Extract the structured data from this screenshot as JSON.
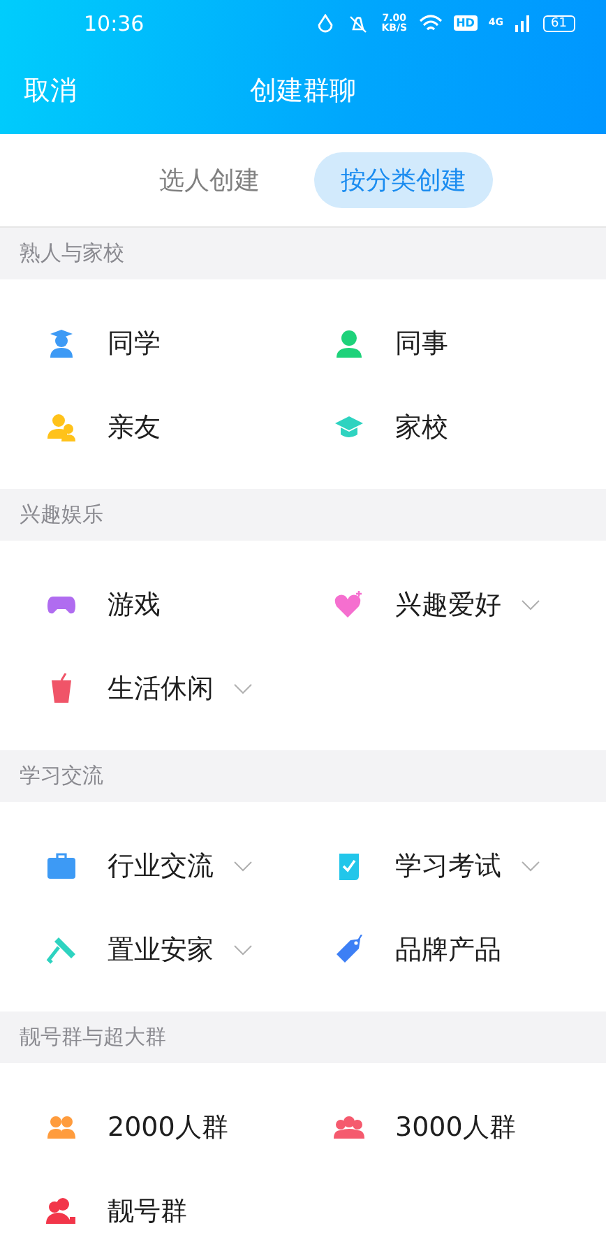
{
  "status_bar": {
    "time": "10:36",
    "speed": "7.00",
    "speed_unit": "KB/S",
    "hd": "HD",
    "network": "4G",
    "battery": "61"
  },
  "header": {
    "cancel": "取消",
    "title": "创建群聊"
  },
  "tabs": [
    {
      "label": "选人创建",
      "selected": false
    },
    {
      "label": "按分类创建",
      "selected": true
    }
  ],
  "sections": [
    {
      "title": "熟人与家校",
      "items": [
        {
          "label": "同学",
          "dropdown": false
        },
        {
          "label": "同事",
          "dropdown": false
        },
        {
          "label": "亲友",
          "dropdown": false
        },
        {
          "label": "家校",
          "dropdown": false
        }
      ]
    },
    {
      "title": "兴趣娱乐",
      "items": [
        {
          "label": "游戏",
          "dropdown": false
        },
        {
          "label": "兴趣爱好",
          "dropdown": true
        },
        {
          "label": "生活休闲",
          "dropdown": true
        }
      ]
    },
    {
      "title": "学习交流",
      "items": [
        {
          "label": "行业交流",
          "dropdown": true
        },
        {
          "label": "学习考试",
          "dropdown": true
        },
        {
          "label": "置业安家",
          "dropdown": true
        },
        {
          "label": "品牌产品",
          "dropdown": false
        }
      ]
    },
    {
      "title": "靓号群与超大群",
      "items": [
        {
          "label": "2000人群",
          "dropdown": false
        },
        {
          "label": "3000人群",
          "dropdown": false
        },
        {
          "label": "靓号群",
          "dropdown": false
        }
      ]
    }
  ]
}
